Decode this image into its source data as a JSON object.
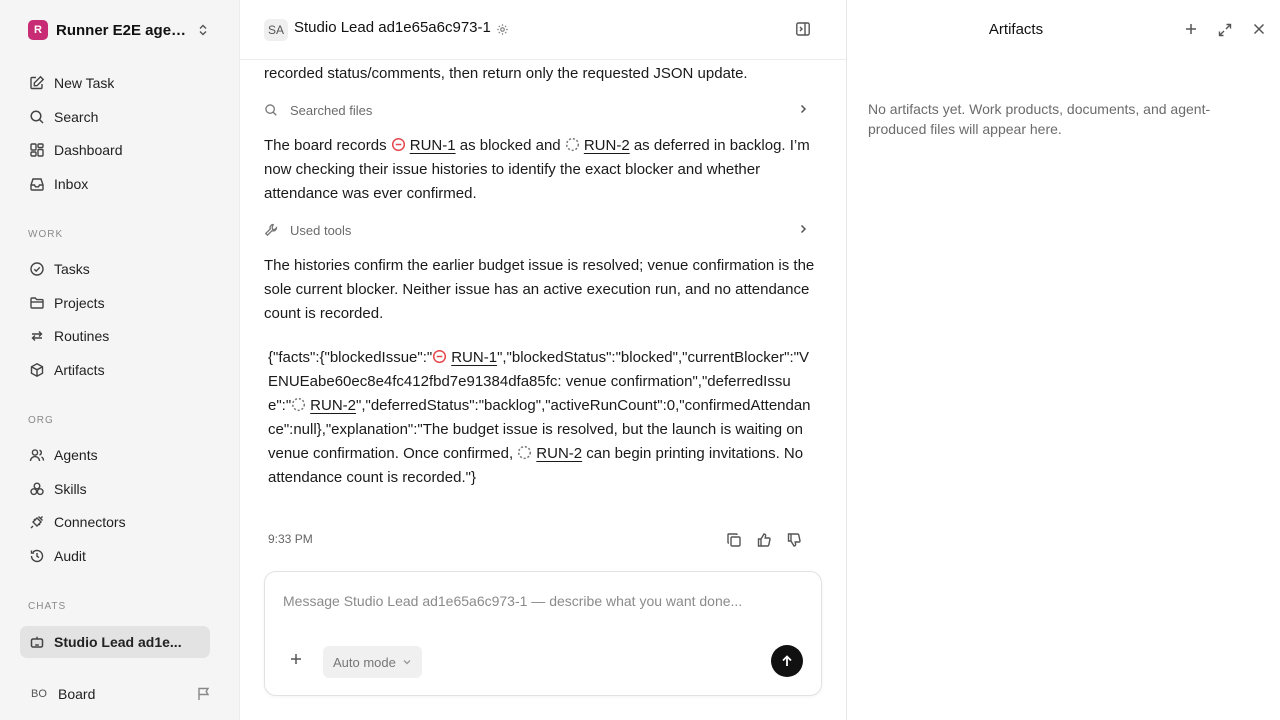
{
  "workspace": {
    "initial": "R",
    "name": "Runner E2E agen..."
  },
  "nav_top": [
    {
      "label": "New Task",
      "icon": "new-task-icon"
    },
    {
      "label": "Search",
      "icon": "search-icon"
    },
    {
      "label": "Dashboard",
      "icon": "dashboard-icon"
    },
    {
      "label": "Inbox",
      "icon": "inbox-icon"
    }
  ],
  "sections": {
    "work": "WORK",
    "org": "ORG",
    "chats": "CHATS"
  },
  "nav_work": [
    {
      "label": "Tasks",
      "icon": "tasks-icon"
    },
    {
      "label": "Projects",
      "icon": "folder-icon"
    },
    {
      "label": "Routines",
      "icon": "routines-icon"
    },
    {
      "label": "Artifacts",
      "icon": "box-icon"
    }
  ],
  "nav_org": [
    {
      "label": "Agents",
      "icon": "agents-icon"
    },
    {
      "label": "Skills",
      "icon": "skills-icon"
    },
    {
      "label": "Connectors",
      "icon": "plug-icon"
    },
    {
      "label": "Audit",
      "icon": "history-icon"
    }
  ],
  "chats": [
    {
      "label": "Studio Lead ad1e...",
      "icon": "robot-icon"
    }
  ],
  "user": {
    "initials": "BO",
    "name": "Board"
  },
  "header": {
    "avatar": "SA",
    "title": "Studio Lead ad1e65a6c973-1"
  },
  "messages": {
    "m0": "recorded status/comments, then return only the requested JSON update.",
    "tool1": "Searched files",
    "m1": {
      "t1": "The board records ",
      "issue1": "RUN-1",
      "t2": " as blocked and ",
      "issue2": "RUN-2",
      "t3": " as deferred in backlog. I’m now checking their issue histories to identify the exact blocker and whether attendance was ever confirmed."
    },
    "tool2": "Used tools",
    "m2": "The histories confirm the earlier budget issue is resolved; venue confirmation is the sole current blocker. Neither issue has an active execution run, and no attendance count is recorded.",
    "json": {
      "p1": "{\"facts\":{\"blockedIssue\":\"",
      "issue1": "RUN-1",
      "p2": "\",\"blockedStatus\":\"blocked\",\"currentBlocker\":\"VENUEabe60ec8e4fc412fbd7e91384dfa85fc: venue confirmation\",\"deferredIssue\":\"",
      "issue2": "RUN-2",
      "p3": "\",\"deferredStatus\":\"backlog\",\"activeRunCount\":0,\"confirmedAttendance\":null},\"explanation\":\"The budget issue is resolved, but the launch is waiting on venue confirmation. Once confirmed, ",
      "issue3": "RUN-2",
      "p4": " can begin printing invitations. No attendance count is recorded.\"}"
    },
    "time": "9:33 PM"
  },
  "composer": {
    "placeholder": "Message Studio Lead ad1e65a6c973-1 — describe what you want done...",
    "mode": "Auto mode"
  },
  "artifacts": {
    "title": "Artifacts",
    "empty": "No artifacts yet. Work products, documents, and agent-produced files will appear here."
  },
  "colors": {
    "blocked": "#e5484d",
    "accent_logo": "#c72c74",
    "send": "#111111"
  }
}
